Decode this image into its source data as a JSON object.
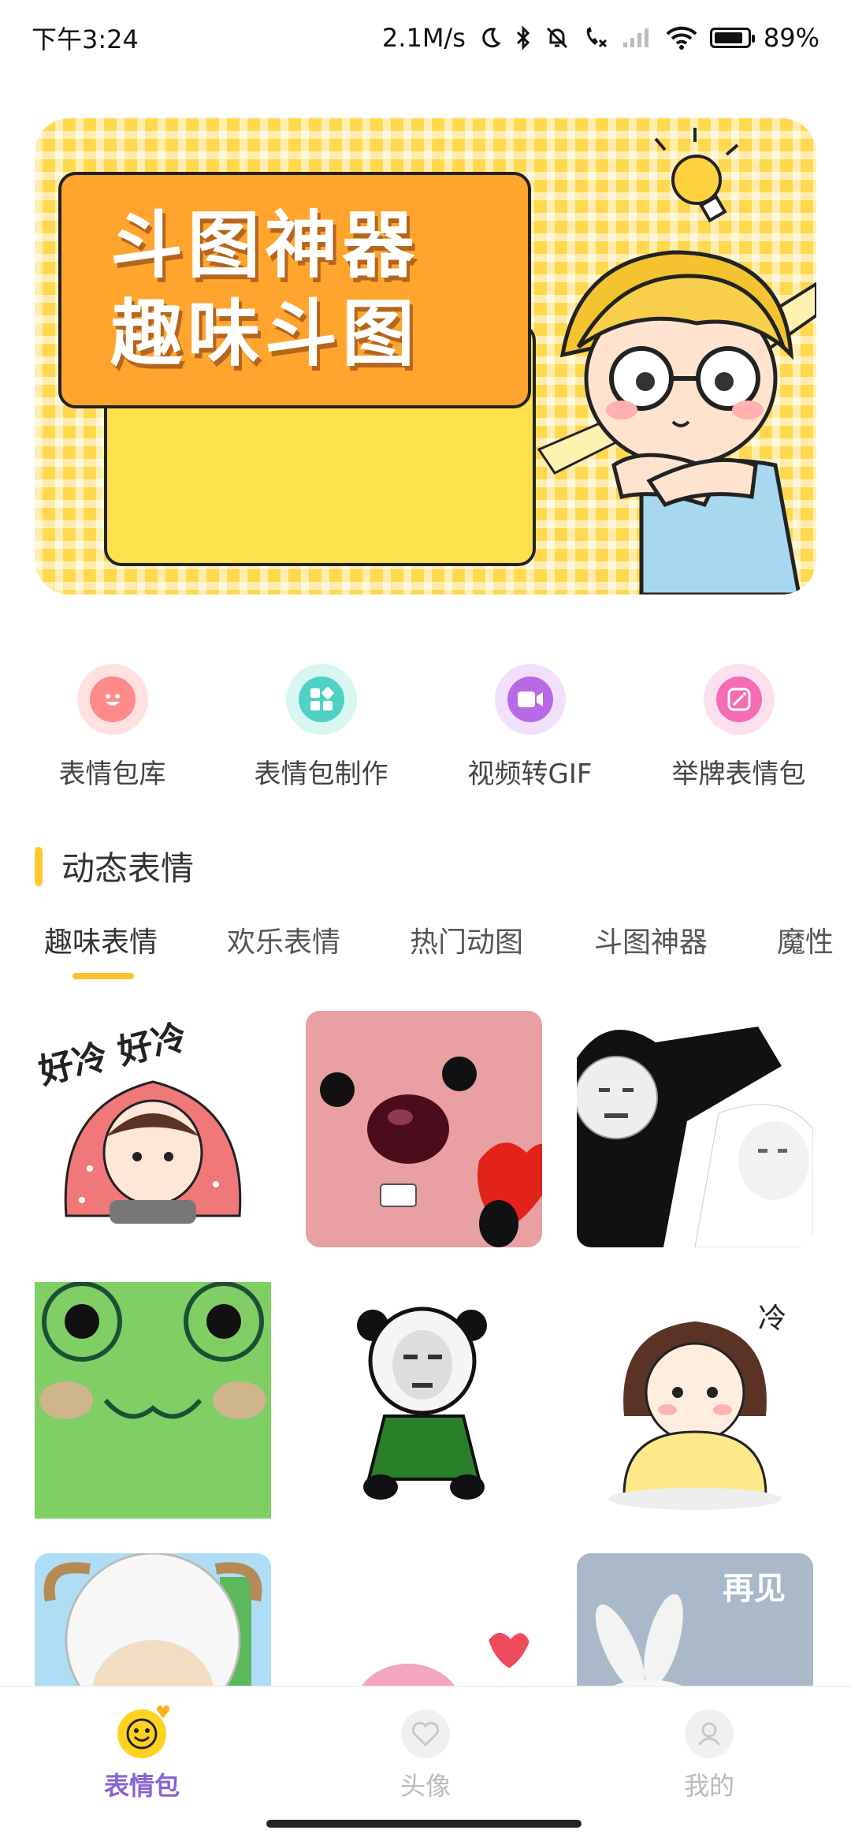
{
  "status_bar": {
    "time": "下午3:24",
    "net_speed": "2.1M/s",
    "battery": "89%",
    "battery_level": 0.89
  },
  "banner": {
    "line1": "斗图神器",
    "line2": "趣味斗图"
  },
  "quick_entries": [
    {
      "label": "表情包库",
      "icon": "smile-icon",
      "color": "#ff8a8a"
    },
    {
      "label": "表情包制作",
      "icon": "blocks-icon",
      "color": "#4fd1c5"
    },
    {
      "label": "视频转GIF",
      "icon": "video-icon",
      "color": "#b86ae6"
    },
    {
      "label": "举牌表情包",
      "icon": "magic-wand-icon",
      "color": "#f56bb4"
    }
  ],
  "section": {
    "title": "动态表情"
  },
  "tabs": [
    "趣味表情",
    "欢乐表情",
    "热门动图",
    "斗图神器",
    "魔性"
  ],
  "grid_stickers": [
    {
      "name": "sticker-cold-girl",
      "text": "好冷 好冷"
    },
    {
      "name": "sticker-pink-beaver"
    },
    {
      "name": "sticker-panda-meme"
    },
    {
      "name": "sticker-green-frog"
    },
    {
      "name": "sticker-panda-squat"
    },
    {
      "name": "sticker-cold-girl-blanket",
      "text": "冷"
    },
    {
      "name": "sticker-sheep"
    },
    {
      "name": "sticker-pink-blob"
    },
    {
      "name": "sticker-bunny-bye",
      "text": "再见"
    }
  ],
  "bottom_nav": [
    {
      "label": "表情包",
      "icon": "emoji-face-icon",
      "active": true
    },
    {
      "label": "头像",
      "icon": "heart-avatar-icon",
      "active": false
    },
    {
      "label": "我的",
      "icon": "user-icon",
      "active": false
    }
  ],
  "colors": {
    "accent_yellow": "#ffc82c",
    "active_nav": "#8a63d2",
    "banner_orange": "#ffa52e"
  }
}
